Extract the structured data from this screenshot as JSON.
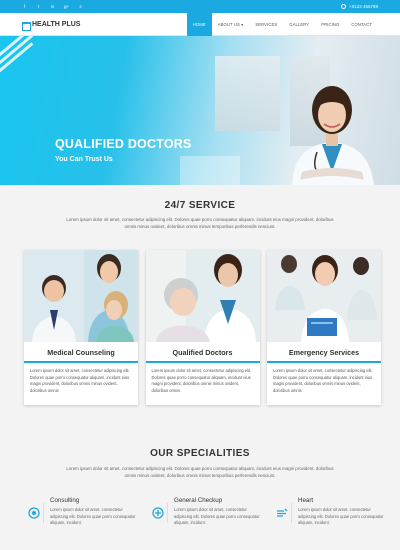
{
  "topbar": {
    "social_icons": [
      "facebook-icon",
      "twitter-icon",
      "linkedin-icon",
      "google-plus-icon",
      "skype-icon"
    ],
    "social_glyphs": [
      "f",
      "t",
      "in",
      "g+",
      "s"
    ],
    "phone": "+0123 456789"
  },
  "navbar": {
    "logo": "HEALTH PLUS",
    "items": [
      {
        "label": "HOME",
        "active": true
      },
      {
        "label": "ABOUT US ▾",
        "active": false
      },
      {
        "label": "SERVICES",
        "active": false
      },
      {
        "label": "GALLERY",
        "active": false
      },
      {
        "label": "PRICING",
        "active": false
      },
      {
        "label": "CONTACT",
        "active": false
      }
    ]
  },
  "hero": {
    "title": "QUALIFIED DOCTORS",
    "subtitle": "You Can Trust Us"
  },
  "services": {
    "title": "24/7 SERVICE",
    "text": "Lorem ipsum dolor sit amet, consectetur adipiscing elit. Dolores quae porro consequatur aliquam, incidunt eius magni provident, doloribus omnis minus ovident, doloribus omnis minus temporibus perferendis nesciunt.",
    "cards": [
      {
        "label": "Medical Counseling",
        "text": "Lorem ipsum dolor sit amet, consectetur adipiscing elit. Dolores quae porro consequatur aliquam, incidunt eius magni provident, doloribus omnis minus ovident, doloribus omnis"
      },
      {
        "label": "Qualified Doctors",
        "text": "Lorem ipsum dolor sit amet, consectetur adipiscing elit. Dolores quae porro consequatur aliquam, incidunt eius magni provident, doloribus omnis minus ovident, doloribus omnis"
      },
      {
        "label": "Emergency Services",
        "text": "Lorem ipsum dolor sit amet, consectetur adipiscing elit. Dolores quae porro consequatur aliquam, incidunt eius magni provident, doloribus omnis minus ovident, doloribus omnis"
      }
    ]
  },
  "specialities": {
    "title": "OUR SPECIALITIES",
    "text": "Lorem ipsum dolor sit amet, consectetur adipiscing elit. Dolores quae porro consequatur aliquam, incidunt eius magni provident, doloribus omnis minus ovident, doloribus omnis minus temporibus perferendis nesciunt.",
    "items": [
      {
        "icon": "target-icon",
        "title": "Consulting",
        "text": "Lorem ipsum dolor sit amet, consectetur adipiscing elit. Dolores quae porro consequatur aliquam, incidunt."
      },
      {
        "icon": "stethoscope-icon",
        "title": "General Checkup",
        "text": "Lorem ipsum dolor sit amet, consectetur adipiscing elit. Dolores quae porro consequatur aliquam, incidunt."
      },
      {
        "icon": "heart-icon",
        "title": "Heart",
        "text": "Lorem ipsum dolor sit amet, consectetur adipiscing elit. Dolores quae porro consequatur aliquam, incidunt."
      }
    ]
  },
  "colors": {
    "accent": "#1aa9e1"
  }
}
